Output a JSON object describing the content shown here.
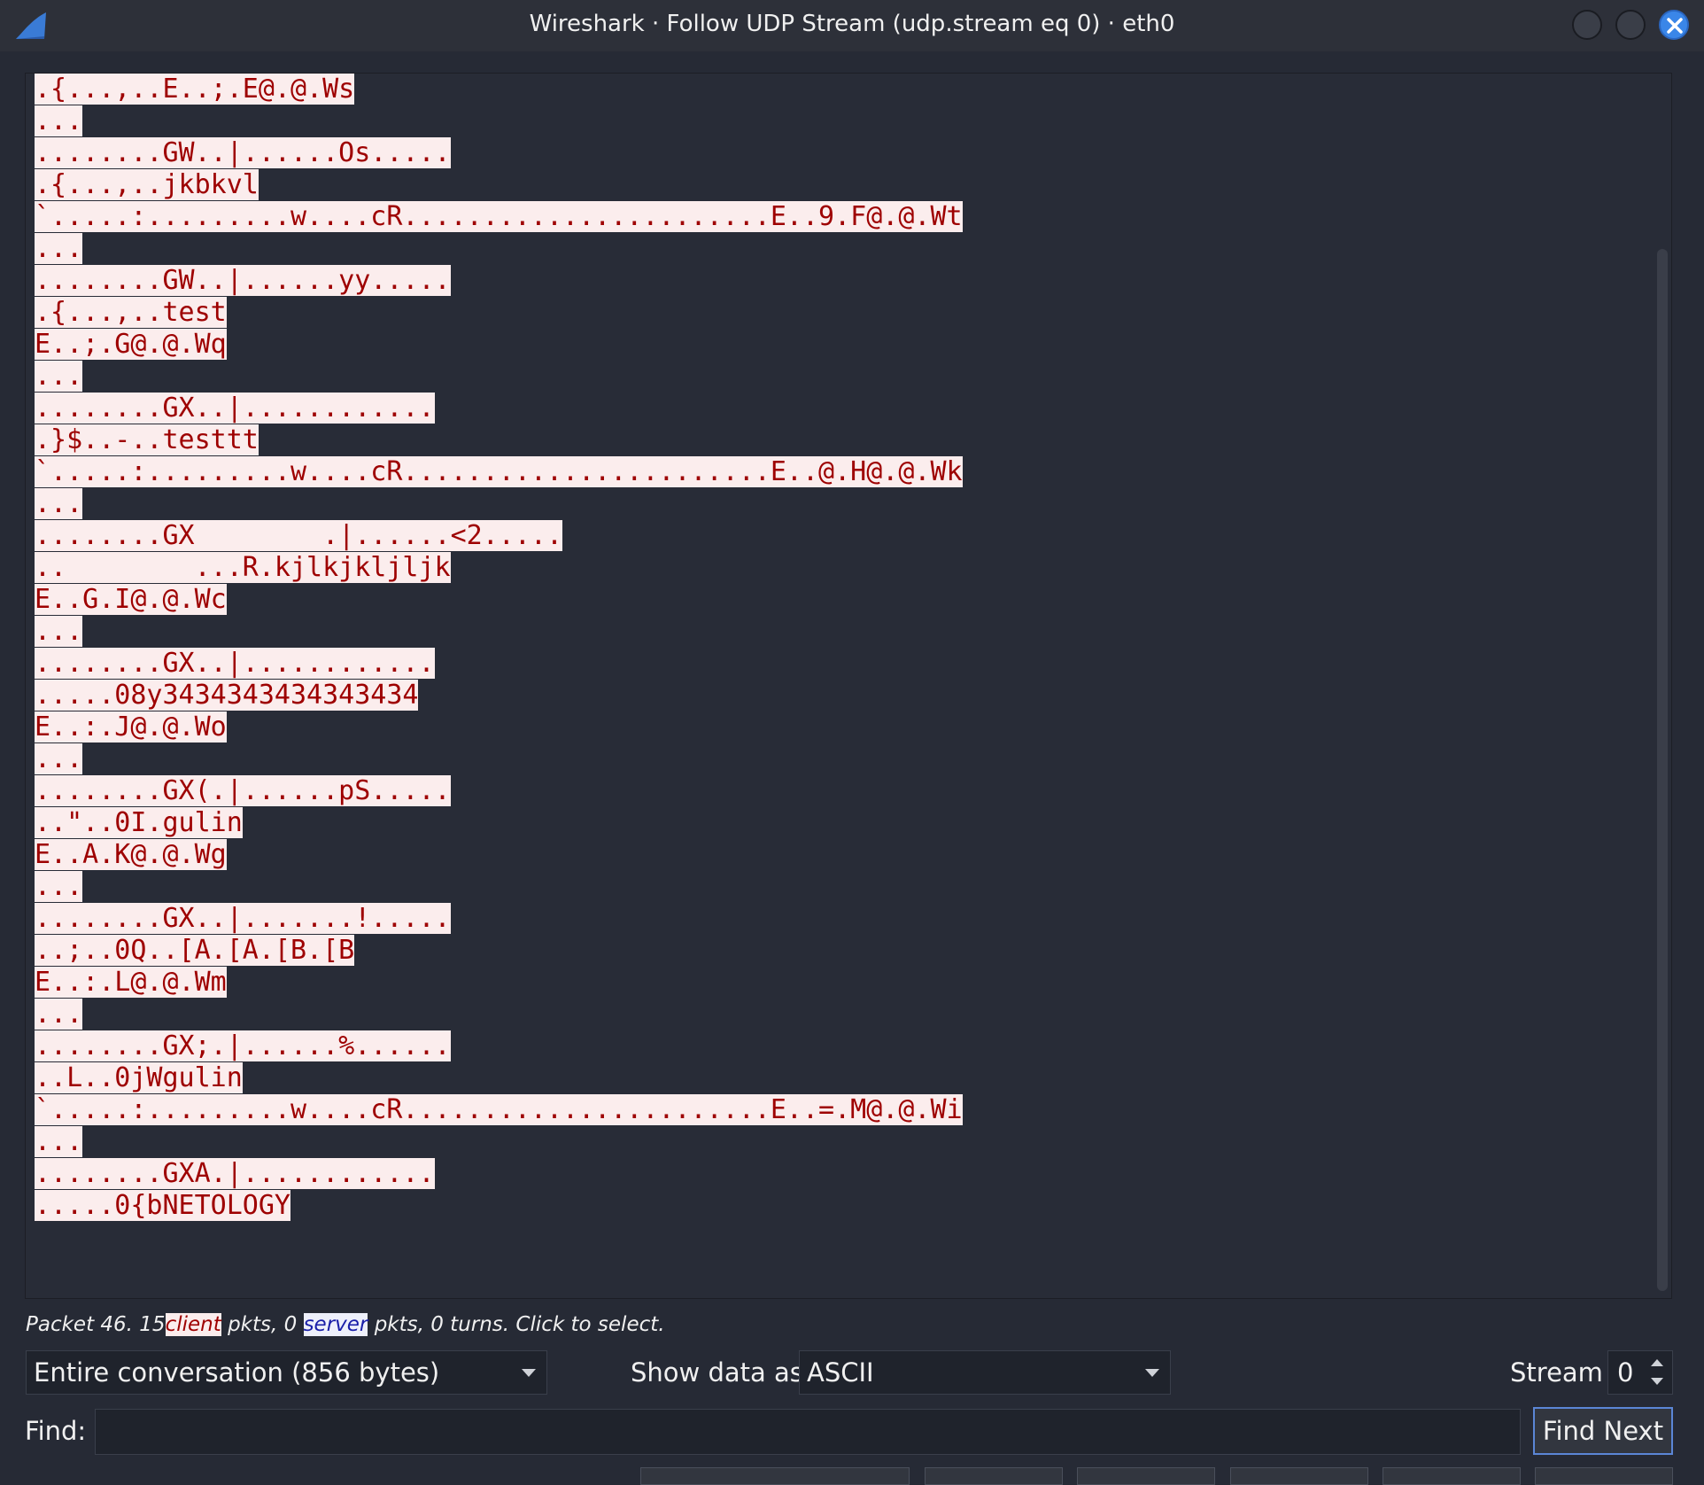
{
  "window": {
    "title": "Wireshark · Follow UDP Stream (udp.stream eq 0) · eth0"
  },
  "stream": {
    "lines": [
      ".{...,..E..;.E@.@.Ws",
      "...",
      "........GW..|......Os.....",
      ".{...,..jkbkvl",
      "`.....:.........w....cR.......................E..9.F@.@.Wt",
      "...",
      "........GW..|......yy.....",
      ".{...,..test",
      "E..;.G@.@.Wq",
      "...",
      "........GX..|............",
      ".}$..-..testtt",
      "`.....:.........w....cR.......................E..@.H@.@.Wk",
      "...",
      "........GX        .|......<2.....",
      "..        ...R.kjlkjkljljk",
      "E..G.I@.@.Wc",
      "...",
      "........GX..|............",
      ".....08y3434343434343434",
      "E..:.J@.@.Wo",
      "...",
      "........GX(.|......pS.....",
      "..\"..0I.gulin",
      "E..A.K@.@.Wg",
      "...",
      "........GX..|.......!.....",
      "..;..0Q..[A.[A.[B.[B",
      "E..:.L@.@.Wm",
      "...",
      "........GX;.|......%......",
      "..L..0jWgulin",
      "`.....:.........w....cR.......................E..=.M@.@.Wi",
      "...",
      "........GXA.|............",
      ".....0{bNETOLOGY"
    ]
  },
  "status": {
    "prefix": "Packet 46. 15",
    "client": "client",
    "middle": "pkts, 0",
    "server": "server",
    "suffix": "pkts, 0 turns. Click to select."
  },
  "controls": {
    "conversation": "Entire conversation (856 bytes)",
    "show_data_label": "Show data as",
    "show_data_value": "ASCII",
    "stream_label": "Stream",
    "stream_value": "0",
    "find_label": "Find:",
    "find_value": "",
    "find_next": "Find Next"
  }
}
